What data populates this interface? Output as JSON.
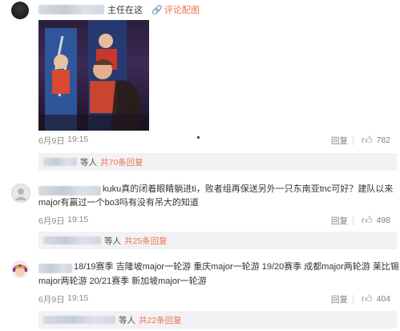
{
  "comment1": {
    "text": "主任在这",
    "link_icon": "link-icon",
    "link_text": "评论配图",
    "date": "6月9日",
    "time": "19:15",
    "reply_label": "回复",
    "like_count": "782",
    "replies_people": "等人",
    "replies_link": "共70条回复"
  },
  "comment2": {
    "line1": "kuku真的闭着眼睛躺进ti，败者组再保送另外一只东南亚tnc可好？建队以来",
    "line2": "major有赢过一个bo3吗有没有吊大的知道",
    "date": "6月9日",
    "time": "19:15",
    "reply_label": "回复",
    "like_count": "498",
    "replies_people": "等人",
    "replies_link": "共25条回复"
  },
  "comment3": {
    "line1": "18/19赛季 吉隆坡major一轮游  重庆major一轮游 19/20赛季 成都major两轮游 莱比锡",
    "line2": "major两轮游 20/21赛季 新加坡major一轮游",
    "date": "6月9日",
    "time": "19:15",
    "reply_label": "回复",
    "like_count": "404",
    "replies_people": "等人",
    "replies_link": "共22条回复"
  },
  "colors": {
    "link": "#eb7350",
    "reply_bg": "#f2f2f5",
    "meta": "#8a8a8a"
  }
}
